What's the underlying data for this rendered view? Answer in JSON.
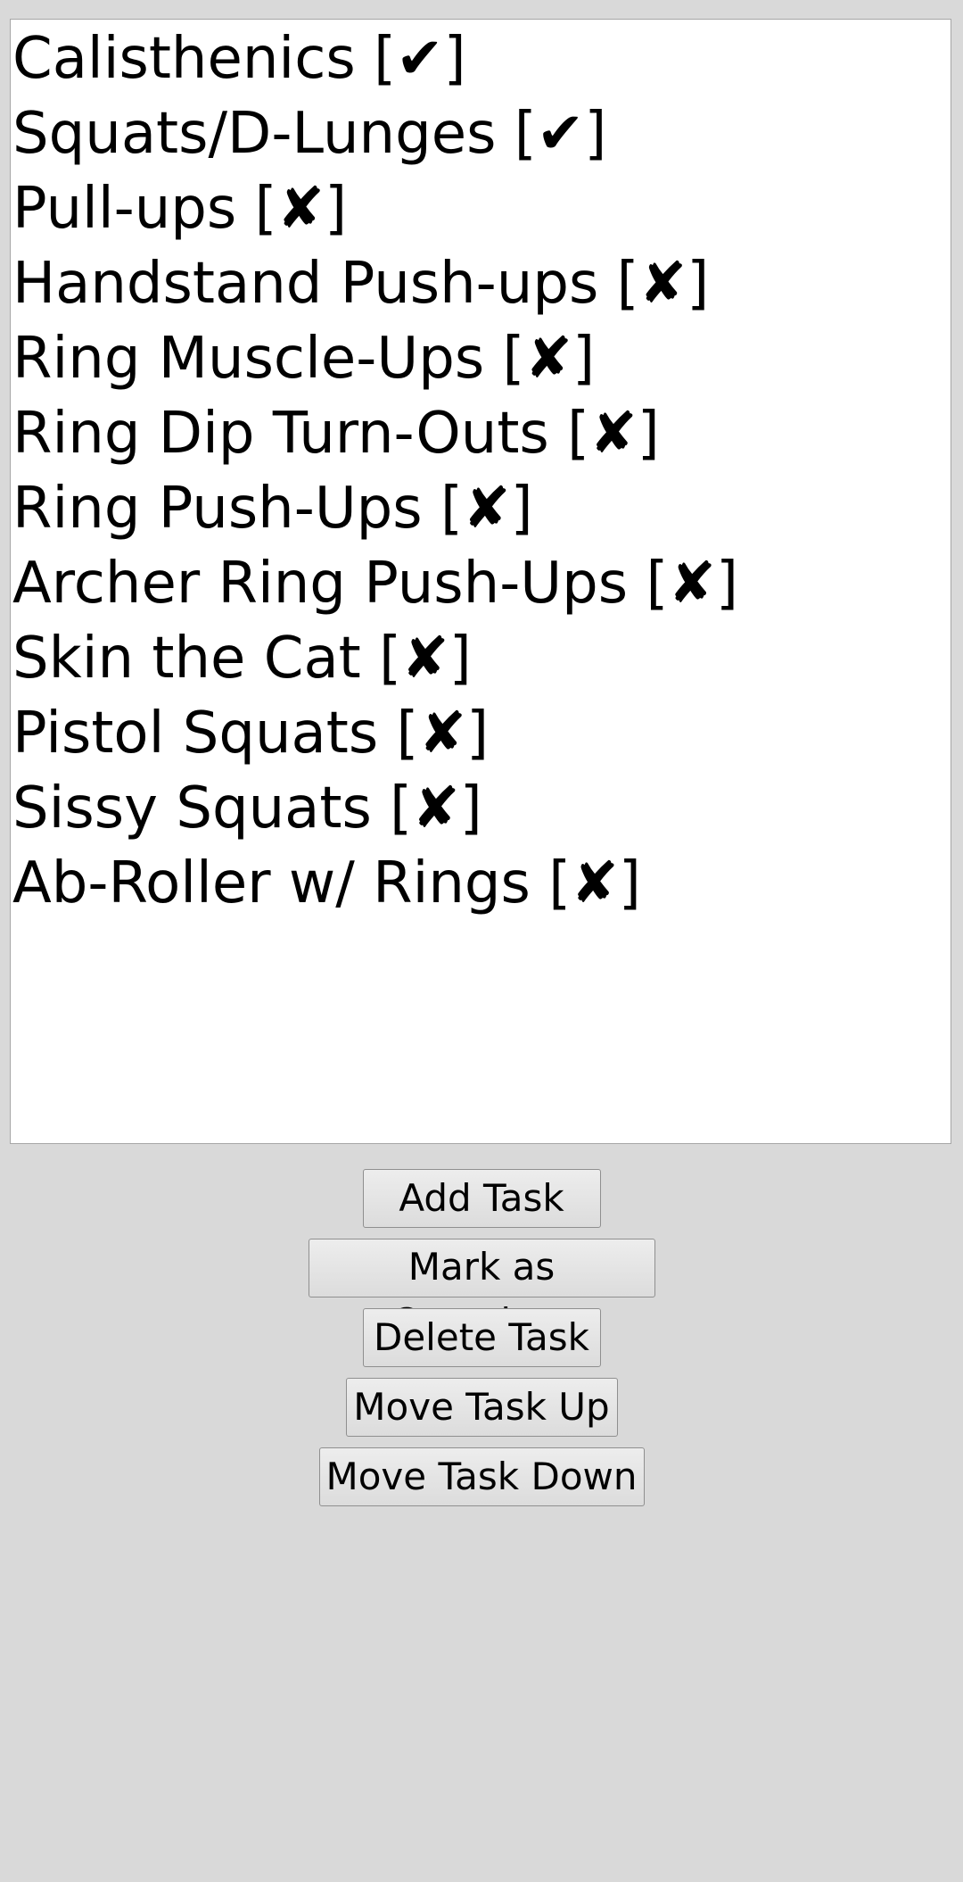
{
  "tasks": [
    {
      "name": "Calisthenics",
      "status": "[✔]"
    },
    {
      "name": "Squats/D-Lunges",
      "status": "[✔]"
    },
    {
      "name": "Pull-ups",
      "status": "[✘]"
    },
    {
      "name": "Handstand Push-ups",
      "status": "[✘]"
    },
    {
      "name": "Ring Muscle-Ups",
      "status": "[✘]"
    },
    {
      "name": "Ring Dip Turn-Outs",
      "status": "[✘]"
    },
    {
      "name": "Ring Push-Ups",
      "status": "[✘]"
    },
    {
      "name": "Archer Ring Push-Ups",
      "status": "[✘]"
    },
    {
      "name": "Skin the Cat",
      "status": "[✘]"
    },
    {
      "name": "Pistol Squats",
      "status": "[✘]"
    },
    {
      "name": "Sissy Squats",
      "status": "[✘]"
    },
    {
      "name": "Ab-Roller w/ Rings",
      "status": "[✘]"
    }
  ],
  "buttons": {
    "add_task": "Add Task",
    "mark_complete": "Mark as Complete",
    "delete_task": "Delete Task",
    "move_up": "Move Task Up",
    "move_down": "Move Task Down"
  },
  "colors": {
    "background": "#d9d9d9",
    "list_background": "#ffffff",
    "text": "#000000"
  }
}
